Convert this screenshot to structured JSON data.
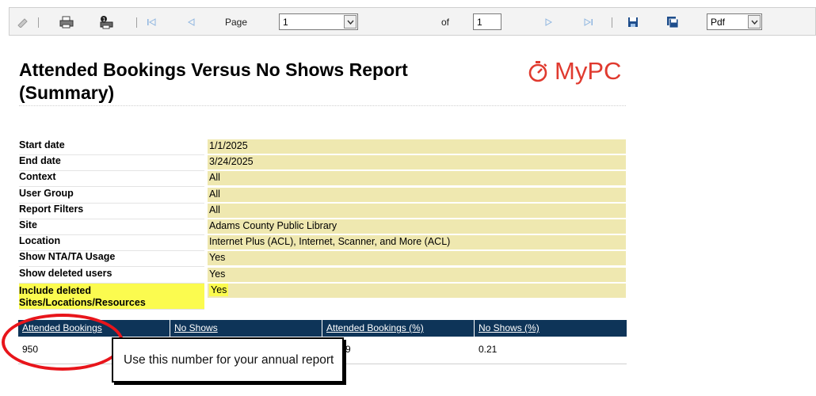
{
  "toolbar": {
    "page_label": "Page",
    "page_value": "1",
    "of_label": "of",
    "total_pages": "1",
    "format_value": "Pdf",
    "icons": [
      "edit-icon",
      "print-icon",
      "print-setup-icon",
      "first-page-icon",
      "previous-page-icon",
      "next-page-icon",
      "last-page-icon",
      "save-icon",
      "save-as-icon"
    ]
  },
  "report": {
    "title_line1": "Attended Bookings Versus No Shows Report",
    "title_line2": "(Summary)",
    "logo_text": "MyPC",
    "brand_color": "#e03a2f"
  },
  "params": [
    {
      "label": "Start date",
      "value": "1/1/2025"
    },
    {
      "label": "End date",
      "value": "3/24/2025"
    },
    {
      "label": "Context",
      "value": "All"
    },
    {
      "label": "User Group",
      "value": "All"
    },
    {
      "label": "Report Filters",
      "value": "All"
    },
    {
      "label": "Site",
      "value": "Adams County Public Library"
    },
    {
      "label": "Location",
      "value": "Internet Plus (ACL), Internet, Scanner, and More (ACL)"
    },
    {
      "label": "Show NTA/TA Usage",
      "value": "Yes"
    },
    {
      "label": "Show deleted users",
      "value": "Yes"
    },
    {
      "label": "Include deleted Sites/Locations/Resources",
      "value": "Yes"
    }
  ],
  "stats": {
    "headers": [
      "Attended Bookings",
      "No Shows",
      "Attended Bookings (%)",
      "No Shows (%)"
    ],
    "values": [
      "950",
      "",
      "9",
      "0.21"
    ],
    "header_color": "#0e3458"
  },
  "annotation": {
    "callout_text": "Use this number for your annual report",
    "circle_color": "#e8151b"
  }
}
